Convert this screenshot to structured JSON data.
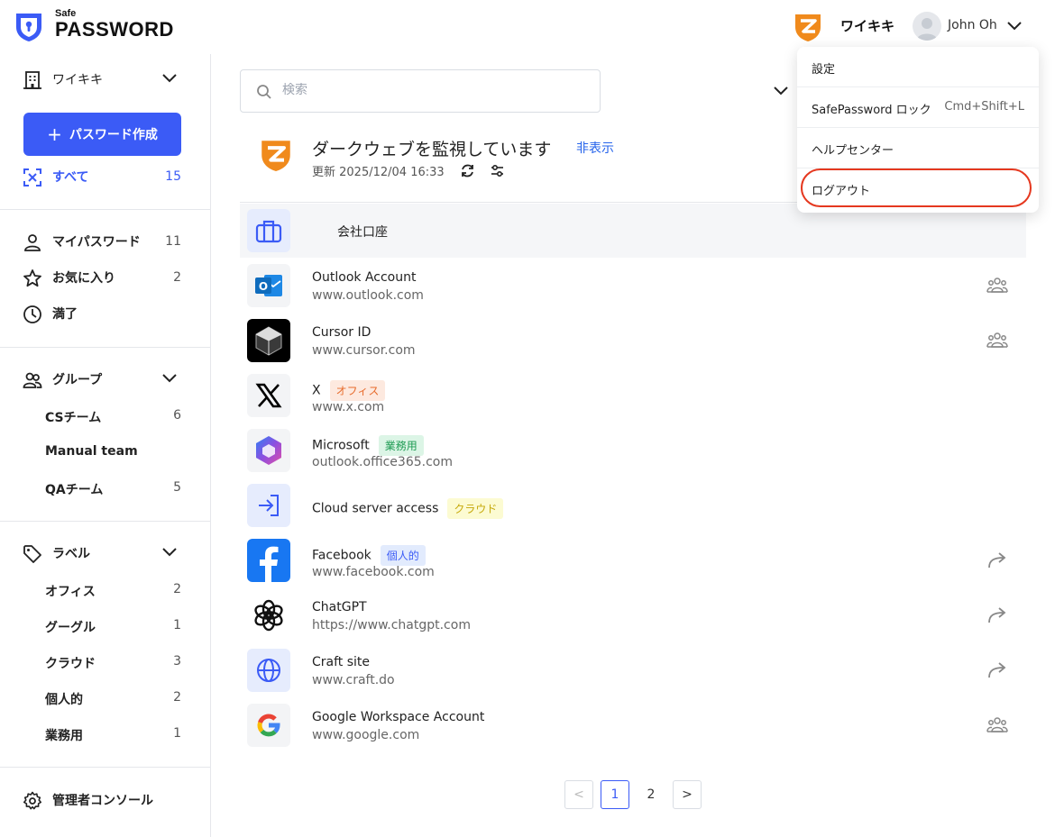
{
  "header": {
    "logo_small": "Safe",
    "logo_big": "PASSWORD",
    "org_name": "ワイキキ",
    "user_name": "John Oh"
  },
  "sidebar": {
    "org_switcher": "ワイキキ",
    "create_button": "パスワード作成",
    "all": {
      "label": "すべて",
      "count": "15"
    },
    "main_items": [
      {
        "label": "マイパスワード",
        "count": "11",
        "icon": "user-icon"
      },
      {
        "label": "お気に入り",
        "count": "2",
        "icon": "star-icon"
      },
      {
        "label": "満了",
        "count": "",
        "icon": "clock-icon"
      }
    ],
    "groups": {
      "label": "グループ",
      "items": [
        {
          "label": "CSチーム",
          "count": "6"
        },
        {
          "label": "Manual team",
          "count": ""
        },
        {
          "label": "QAチーム",
          "count": "5"
        }
      ]
    },
    "labels": {
      "label": "ラベル",
      "items": [
        {
          "label": "オフィス",
          "count": "2"
        },
        {
          "label": "グーグル",
          "count": "1"
        },
        {
          "label": "クラウド",
          "count": "3"
        },
        {
          "label": "個人的",
          "count": "2"
        },
        {
          "label": "業務用",
          "count": "1"
        }
      ]
    },
    "admin_console": "管理者コンソール"
  },
  "main": {
    "search_placeholder": "検索",
    "darkweb": {
      "title": "ダークウェブを監視しています",
      "hide": "非表示",
      "updated": "更新 2025/12/04 16:33"
    },
    "group_header": "会社口座",
    "items": [
      {
        "name": "Outlook Account",
        "url": "www.outlook.com",
        "tag": "",
        "action": "shared-users-icon"
      },
      {
        "name": "Cursor ID",
        "url": "www.cursor.com",
        "tag": "",
        "action": "shared-users-icon"
      },
      {
        "name": "X",
        "url": "www.x.com",
        "tag": "オフィス",
        "action": ""
      },
      {
        "name": "Microsoft",
        "url": "outlook.office365.com",
        "tag": "業務用",
        "action": ""
      },
      {
        "name": "Cloud server access",
        "url": "",
        "tag": "クラウド",
        "action": ""
      },
      {
        "name": "Facebook",
        "url": "www.facebook.com",
        "tag": "個人的",
        "action": "share-arrow-icon"
      },
      {
        "name": "ChatGPT",
        "url": "https://www.chatgpt.com",
        "tag": "",
        "action": "share-arrow-icon"
      },
      {
        "name": "Craft site",
        "url": "www.craft.do",
        "tag": "",
        "action": "share-arrow-icon"
      },
      {
        "name": "Google Workspace Account",
        "url": "www.google.com",
        "tag": "",
        "action": "shared-users-icon"
      }
    ],
    "pagination": {
      "prev": "<",
      "pages": [
        "1",
        "2"
      ],
      "current": "1",
      "next": ">"
    }
  },
  "dropdown": {
    "items": [
      {
        "label": "設定",
        "shortcut": ""
      },
      {
        "label": "SafePassword ロック",
        "shortcut": "Cmd+Shift+L"
      },
      {
        "label": "ヘルプセンター",
        "shortcut": ""
      },
      {
        "label": "ログアウト",
        "shortcut": ""
      }
    ]
  },
  "colors": {
    "primary": "#3b5bf6",
    "accent_orange": "#f08a1c",
    "highlight_ring": "#e5381f",
    "tag_office": "#fde9df",
    "tag_work": "#dcf5e6",
    "tag_cloud": "#fcfbd2",
    "tag_personal": "#e2ebfd"
  }
}
